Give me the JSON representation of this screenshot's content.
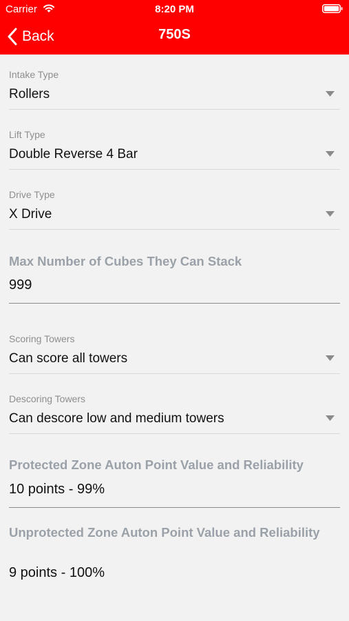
{
  "status_bar": {
    "carrier": "Carrier",
    "time": "8:20 PM"
  },
  "nav": {
    "back_label": "Back",
    "title": "750S"
  },
  "colors": {
    "header_bg": "#ff0000",
    "page_bg": "#f2f2f2"
  },
  "form": {
    "intake": {
      "label": "Intake Type",
      "value": "Rollers"
    },
    "lift": {
      "label": "Lift Type",
      "value": "Double Reverse 4 Bar"
    },
    "drive": {
      "label": "Drive Type",
      "value": "X Drive"
    },
    "max_cubes": {
      "label": "Max Number of Cubes They Can Stack",
      "value": "999"
    },
    "scoring": {
      "label": "Scoring Towers",
      "value": "Can score all towers"
    },
    "descoring": {
      "label": "Descoring Towers",
      "value": "Can descore low and medium towers"
    },
    "protected_auton": {
      "label": "Protected Zone Auton Point Value and Reliability",
      "value": "10 points - 99%"
    },
    "unprotected_auton": {
      "label": "Unprotected Zone Auton Point Value and Reliability",
      "value": "9 points - 100%"
    }
  }
}
